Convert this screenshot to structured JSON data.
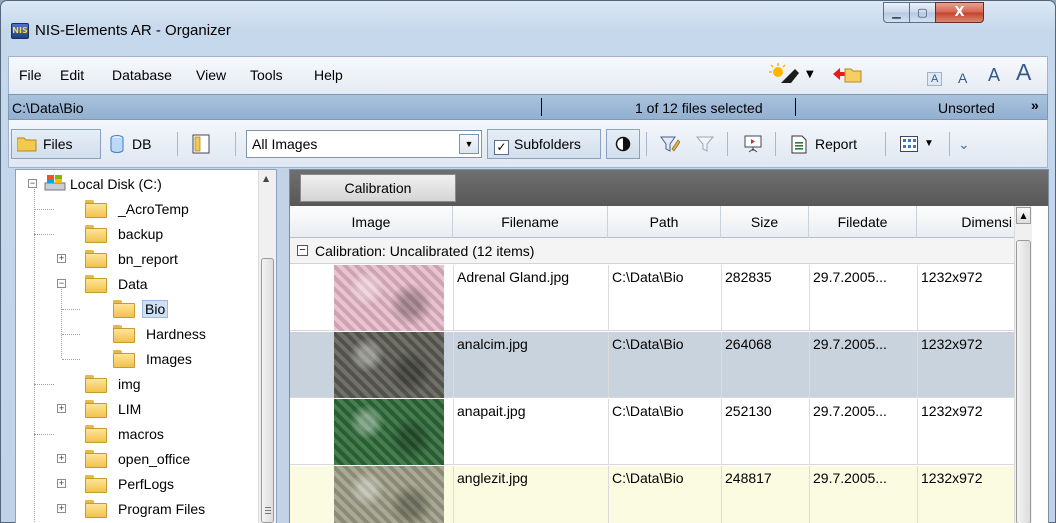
{
  "window": {
    "title": "NIS-Elements AR - Organizer",
    "app_icon_text": "NIS",
    "min_label": "▁",
    "max_label": "▢",
    "close_label": "X"
  },
  "menu": {
    "items": [
      "File",
      "Edit",
      "Database",
      "View",
      "Tools",
      "Help"
    ],
    "font_sizes": [
      "A",
      "A",
      "A",
      "A"
    ]
  },
  "pathbar": {
    "path": "C:\\Data\\Bio",
    "selection": "1 of 12 files selected",
    "sort": "Unsorted",
    "more": "»"
  },
  "toolbar": {
    "files_label": "Files",
    "db_label": "DB",
    "filter_value": "All Images",
    "subfolders_label": "Subfolders",
    "subfolders_checked": "✓",
    "report_label": "Report"
  },
  "tree": {
    "nodes": [
      {
        "label": "Local Disk (C:)",
        "expander": "−"
      },
      {
        "label": "_AcroTemp"
      },
      {
        "label": "backup"
      },
      {
        "label": "bn_report",
        "expander": "+"
      },
      {
        "label": "Data",
        "expander": "−"
      },
      {
        "label": "Bio"
      },
      {
        "label": "Hardness"
      },
      {
        "label": "Images"
      },
      {
        "label": "img"
      },
      {
        "label": "LIM",
        "expander": "+"
      },
      {
        "label": "macros"
      },
      {
        "label": "open_office",
        "expander": "+"
      },
      {
        "label": "PerfLogs",
        "expander": "+"
      },
      {
        "label": "Program Files",
        "expander": "+"
      }
    ],
    "selected": "Bio"
  },
  "grid": {
    "group_by": "Calibration",
    "columns": [
      "Image",
      "Filename",
      "Path",
      "Size",
      "Filedate",
      "Dimensi"
    ],
    "group_row": "Calibration: Uncalibrated (12 items)",
    "group_expander": "−",
    "rows": [
      {
        "filename": "Adrenal Gland.jpg",
        "path": "C:\\Data\\Bio",
        "size": "282835",
        "filedate": "29.7.2005...",
        "dimension": "1232x972"
      },
      {
        "filename": "analcim.jpg",
        "path": "C:\\Data\\Bio",
        "size": "264068",
        "filedate": "29.7.2005...",
        "dimension": "1232x972"
      },
      {
        "filename": "anapait.jpg",
        "path": "C:\\Data\\Bio",
        "size": "252130",
        "filedate": "29.7.2005...",
        "dimension": "1232x972"
      },
      {
        "filename": "anglezit.jpg",
        "path": "C:\\Data\\Bio",
        "size": "248817",
        "filedate": "29.7.2005...",
        "dimension": "1232x972"
      }
    ],
    "row_colors": [
      "#ffffff",
      "#c9d3de",
      "#ffffff",
      "#fbfbe1"
    ],
    "thumb_colors": [
      "#e7b9c9",
      "#5d5d55",
      "#2f6b3a",
      "#9d9d86"
    ]
  }
}
